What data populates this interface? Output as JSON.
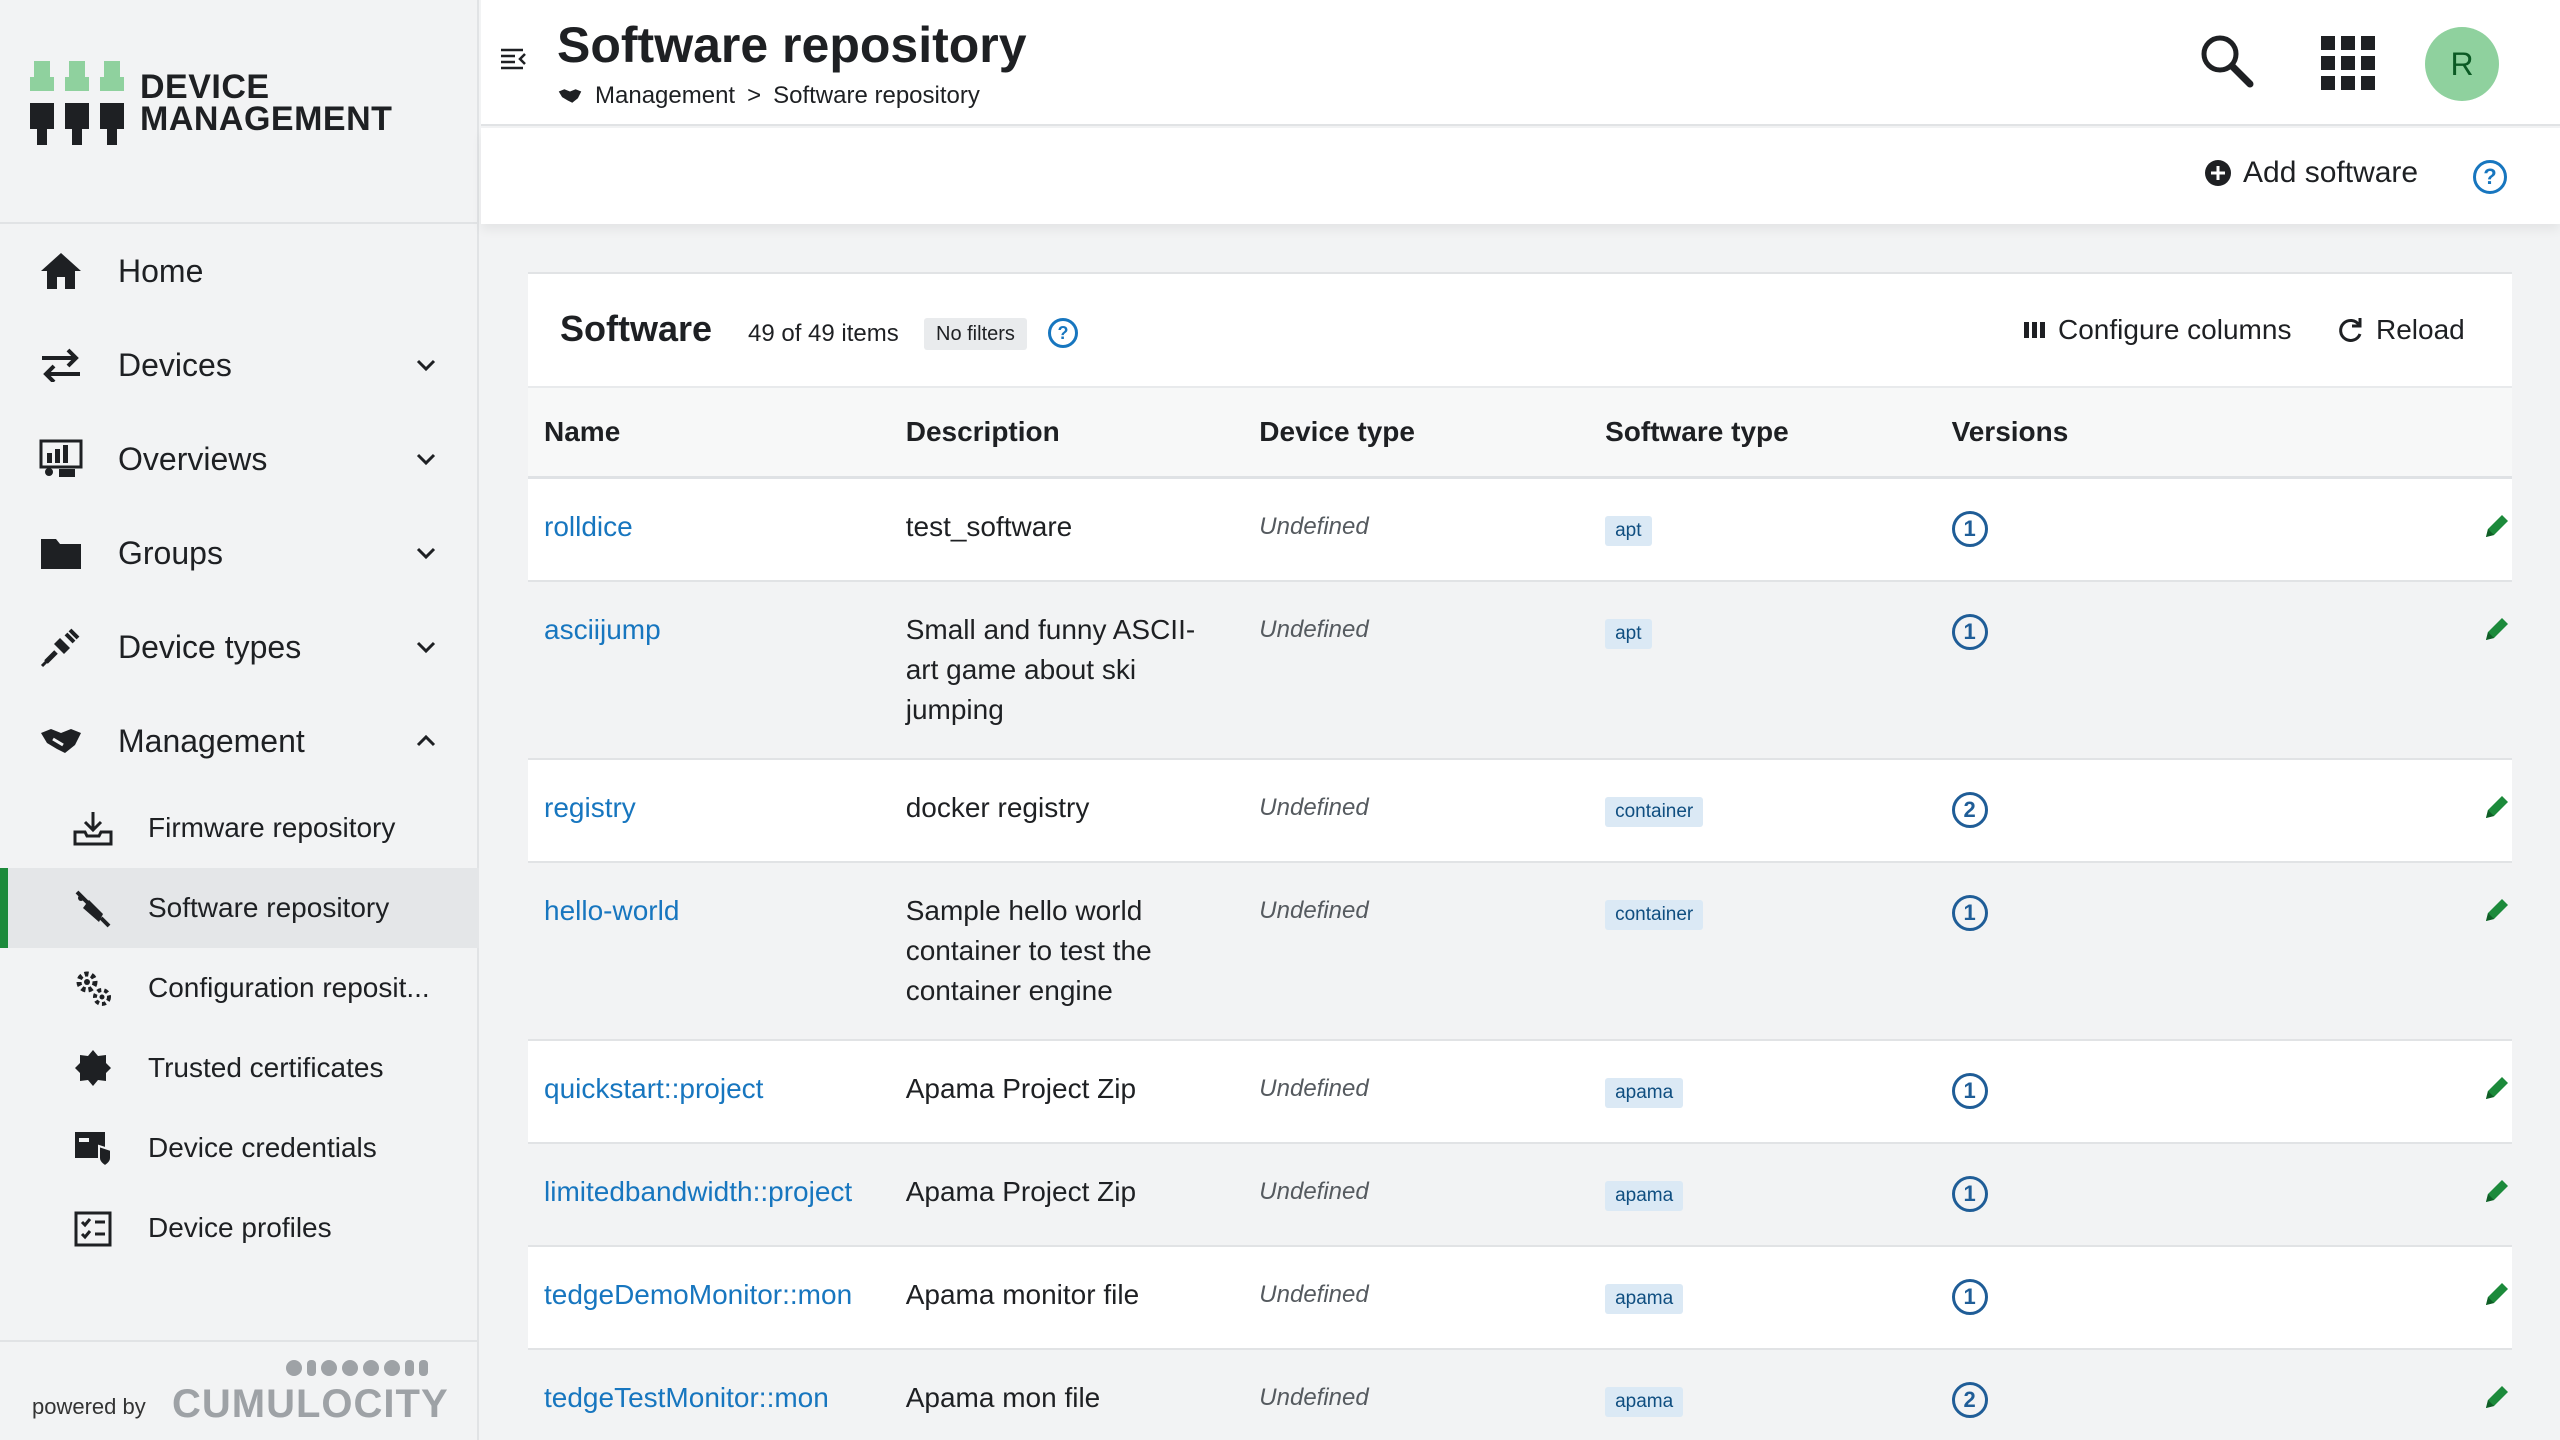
{
  "brand": {
    "line1": "DEVICE",
    "line2": "MANAGEMENT",
    "powered_by": "powered by",
    "vendor": "CUMULOCITY"
  },
  "nav": {
    "home": "Home",
    "devices": "Devices",
    "overviews": "Overviews",
    "groups": "Groups",
    "device_types": "Device types",
    "management": "Management",
    "sub": {
      "firmware": "Firmware repository",
      "software": "Software repository",
      "configuration": "Configuration reposit...",
      "certificates": "Trusted certificates",
      "credentials": "Device credentials",
      "profiles": "Device profiles"
    }
  },
  "header": {
    "title": "Software repository",
    "breadcrumb_parent": "Management",
    "breadcrumb_sep": ">",
    "breadcrumb_current": "Software repository",
    "avatar_initial": "R"
  },
  "actions": {
    "add_software": "Add software",
    "help": "?"
  },
  "card": {
    "title": "Software",
    "count": "49 of 49 items",
    "filters": "No filters",
    "help": "?",
    "configure_columns": "Configure columns",
    "reload": "Reload"
  },
  "table": {
    "columns": [
      "Name",
      "Description",
      "Device type",
      "Software type",
      "Versions"
    ],
    "rows": [
      {
        "name": "rolldice",
        "description": "test_software",
        "device_type": "Undefined",
        "software_type": "apt",
        "versions": "1"
      },
      {
        "name": "asciijump",
        "description": "Small and funny ASCII-art game about ski jumping",
        "device_type": "Undefined",
        "software_type": "apt",
        "versions": "1"
      },
      {
        "name": "registry",
        "description": "docker registry",
        "device_type": "Undefined",
        "software_type": "container",
        "versions": "2"
      },
      {
        "name": "hello-world",
        "description": "Sample hello world container to test the container engine",
        "device_type": "Undefined",
        "software_type": "container",
        "versions": "1"
      },
      {
        "name": "quickstart::project",
        "description": "Apama Project Zip",
        "device_type": "Undefined",
        "software_type": "apama",
        "versions": "1"
      },
      {
        "name": "limitedbandwidth::project",
        "description": "Apama Project Zip",
        "device_type": "Undefined",
        "software_type": "apama",
        "versions": "1"
      },
      {
        "name": "tedgeDemoMonitor::mon",
        "description": "Apama monitor file",
        "device_type": "Undefined",
        "software_type": "apama",
        "versions": "1"
      },
      {
        "name": "tedgeTestMonitor::mon",
        "description": "Apama mon file",
        "device_type": "Undefined",
        "software_type": "apama",
        "versions": "2"
      }
    ]
  },
  "colors": {
    "accent_green": "#1c8a3b",
    "link_blue": "#1776bf",
    "avatar_bg": "#8fd19e"
  },
  "icons": {
    "menu": "menu-toggle-icon",
    "search": "search-icon",
    "apps": "app-grid-icon",
    "add": "plus-circle-icon",
    "help": "help-circle-icon",
    "columns": "columns-icon",
    "reload": "reload-icon",
    "edit": "pencil-icon"
  }
}
